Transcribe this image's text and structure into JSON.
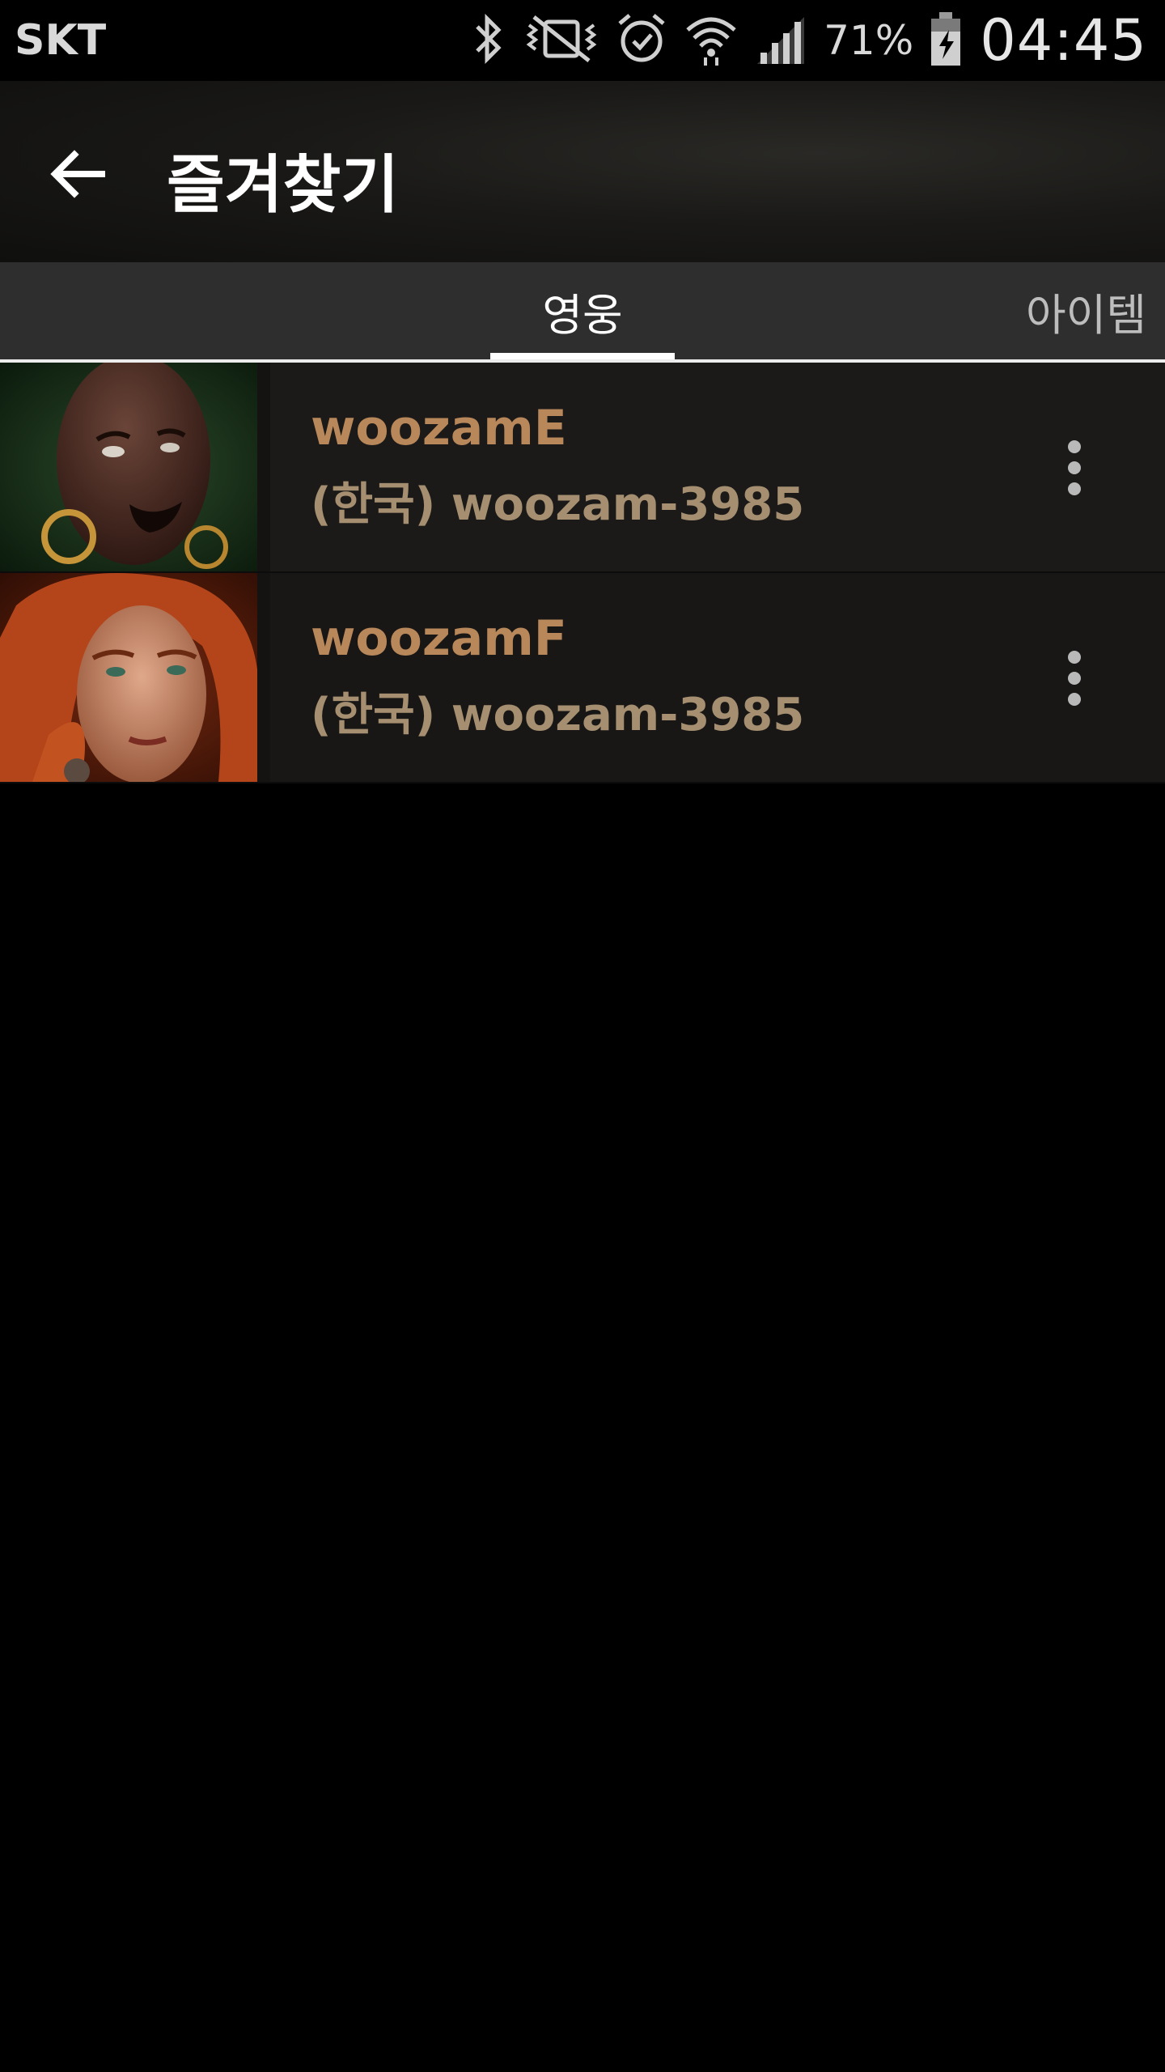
{
  "status_bar": {
    "carrier": "SKT",
    "battery_percent": "71%",
    "time": "04:45",
    "icons": [
      "bluetooth-icon",
      "vibrate-mute-icon",
      "alarm-icon",
      "wifi-icon",
      "signal-icon",
      "battery-charging-icon"
    ]
  },
  "app_bar": {
    "title": "즐겨찾기",
    "back_icon": "arrow-back-icon"
  },
  "tabs": [
    {
      "label": "영웅",
      "selected": true
    },
    {
      "label": "아이템",
      "selected": false
    }
  ],
  "favorites": [
    {
      "name": "woozamE",
      "account": "(한국) woozam-3985",
      "portrait": "witch-doctor-portrait"
    },
    {
      "name": "woozamF",
      "account": "(한국) woozam-3985",
      "portrait": "female-barbarian-portrait"
    }
  ],
  "colors": {
    "name_text": "#b8875a",
    "account_text": "#a58f70",
    "tab_indicator": "#ffffff",
    "list_background": "#1b1a18"
  }
}
